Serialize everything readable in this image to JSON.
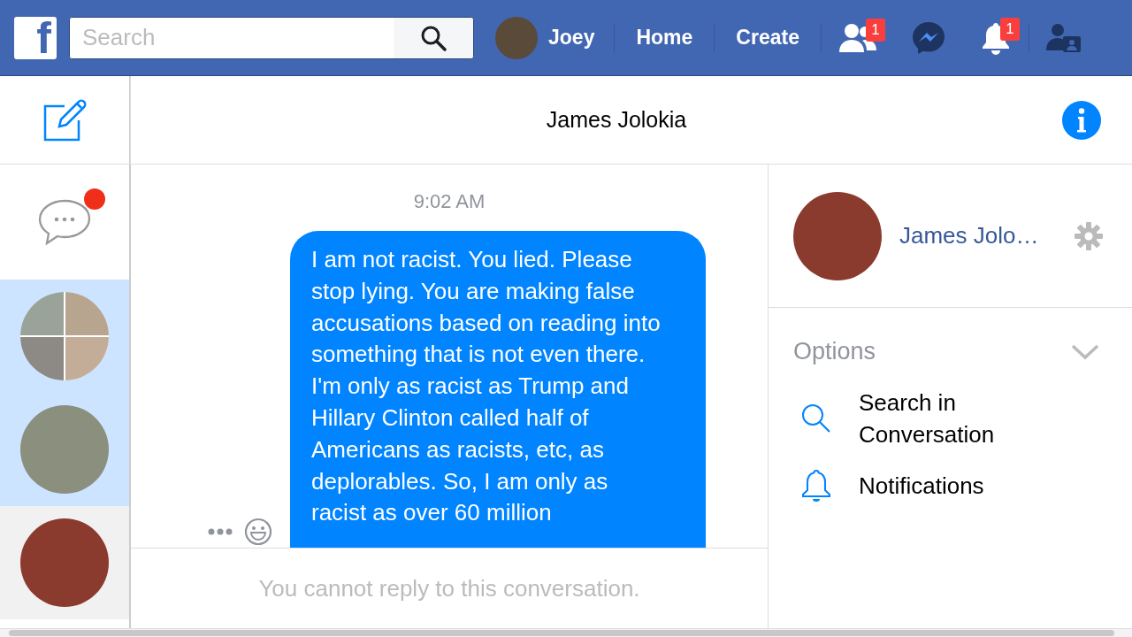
{
  "top_bar": {
    "logo": "f",
    "search": {
      "placeholder": "Search"
    },
    "profile": {
      "name": "Joey"
    },
    "nav_links": [
      "Home",
      "Create"
    ],
    "icons": [
      {
        "kind": "friends",
        "badge": "1"
      },
      {
        "kind": "messenger"
      },
      {
        "kind": "notifications",
        "badge": "1"
      },
      {
        "kind": "account"
      }
    ]
  },
  "sidebar": {
    "chats_unread": true,
    "conversations": [
      {
        "kind": "group",
        "unread": true,
        "selected": false
      },
      {
        "kind": "single",
        "unread": true,
        "selected": false
      },
      {
        "kind": "single",
        "unread": false,
        "selected": true
      }
    ]
  },
  "thread": {
    "title": "James Jolokia",
    "time": "9:02 AM",
    "messages": [
      {
        "text": "I am not racist. You lied. Please stop lying. You are making false accusations based on reading into something that is not even there. I'm only as racist as Trump and Hillary Clinton called half of Americans as racists, etc, as deplorables. So, I am only as racist as over 60 million"
      }
    ],
    "composer": {
      "notice": "You cannot reply to this conversation."
    }
  },
  "info_panel": {
    "name": "James Jolo…",
    "options": {
      "label": "Options",
      "items": [
        {
          "kind": "search",
          "label": "Search in Conversation"
        },
        {
          "kind": "notifications",
          "label": "Notifications"
        }
      ]
    }
  }
}
